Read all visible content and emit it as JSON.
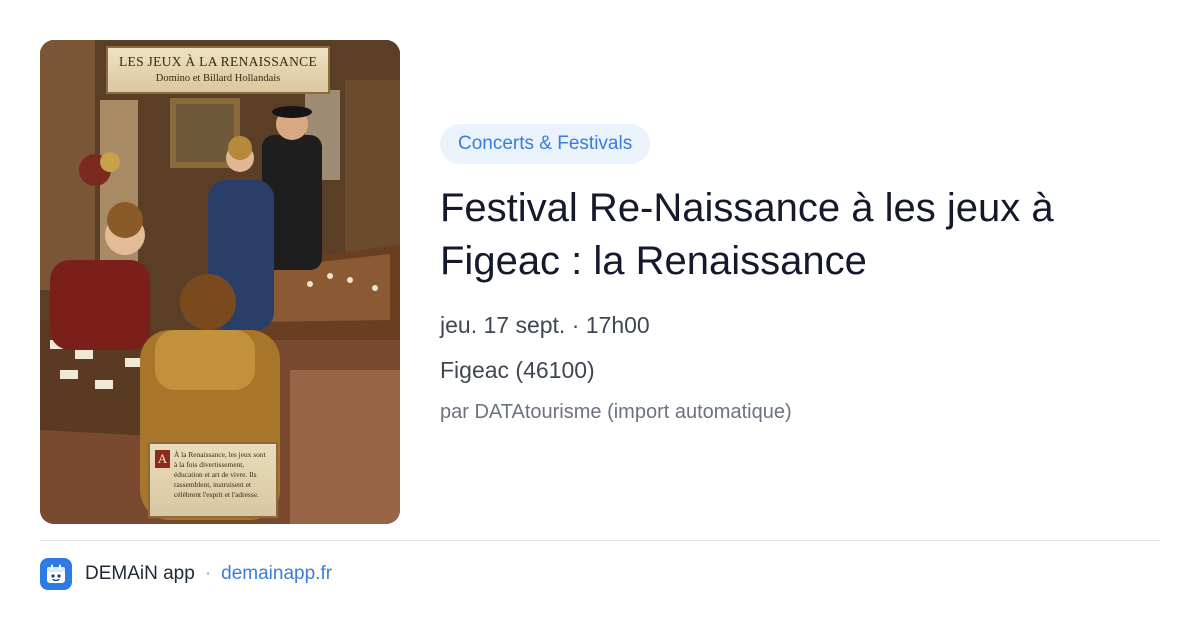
{
  "poster": {
    "banner_title": "LES JEUX À LA RENAISSANCE",
    "banner_subtitle": "Domino et Billard Hollandais",
    "plaque_dropcap": "A",
    "plaque_text": "À la Renaissance, les jeux sont à la fois divertissement, éducation et art de vivre. Ils rassemblent, instruisent et célèbrent l'esprit et l'adresse."
  },
  "event": {
    "category": "Concerts & Festivals",
    "title": "Festival Re-Naissance à les jeux à Figeac : la Renaissance",
    "datetime": "jeu. 17 sept. · 17h00",
    "location": "Figeac (46100)",
    "source": "par DATAtourisme (import automatique)"
  },
  "footer": {
    "app_name": "DEMAiN app",
    "separator": "·",
    "site": "demainapp.fr"
  },
  "colors": {
    "accent": "#3b7dd8",
    "chip_bg": "#eaf2fc",
    "logo_bg": "#2d7be5"
  }
}
